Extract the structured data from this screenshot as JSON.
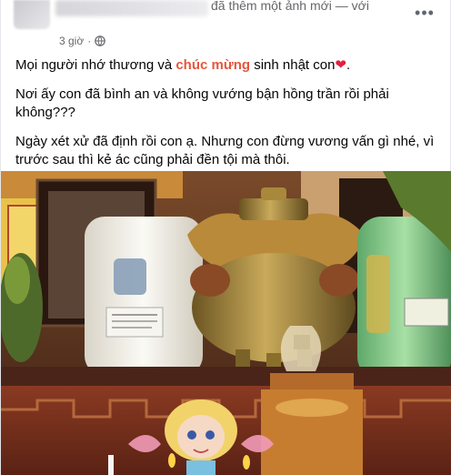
{
  "header": {
    "action_text": "đã thêm một ảnh mới — với",
    "time": "3 giờ",
    "more_icon": "more-horizontal-icon",
    "privacy_icon": "globe-icon"
  },
  "post": {
    "line1_before": "Mọi người nhớ thương và ",
    "line1_highlight": "chúc mừng",
    "line1_after": " sinh nhật con",
    "line1_emoji": "❤",
    "para2": "Nơi ấy con đã bình an và không vướng bận hồng trần rồi phải không???",
    "para3": "Ngày xét xử đã định rồi con ạ. Nhưng con đừng vương vấn gì nhé, vì trước sau thì kẻ ác cũng phải đền tội mà thôi."
  },
  "photo": {
    "alt": "Bàn thờ với hũ tro cốt, lư hương đồng, đèn dầu và búp bê"
  },
  "colors": {
    "highlight": "#e4573d",
    "heart": "#e41e3f",
    "meta": "#65676b"
  }
}
